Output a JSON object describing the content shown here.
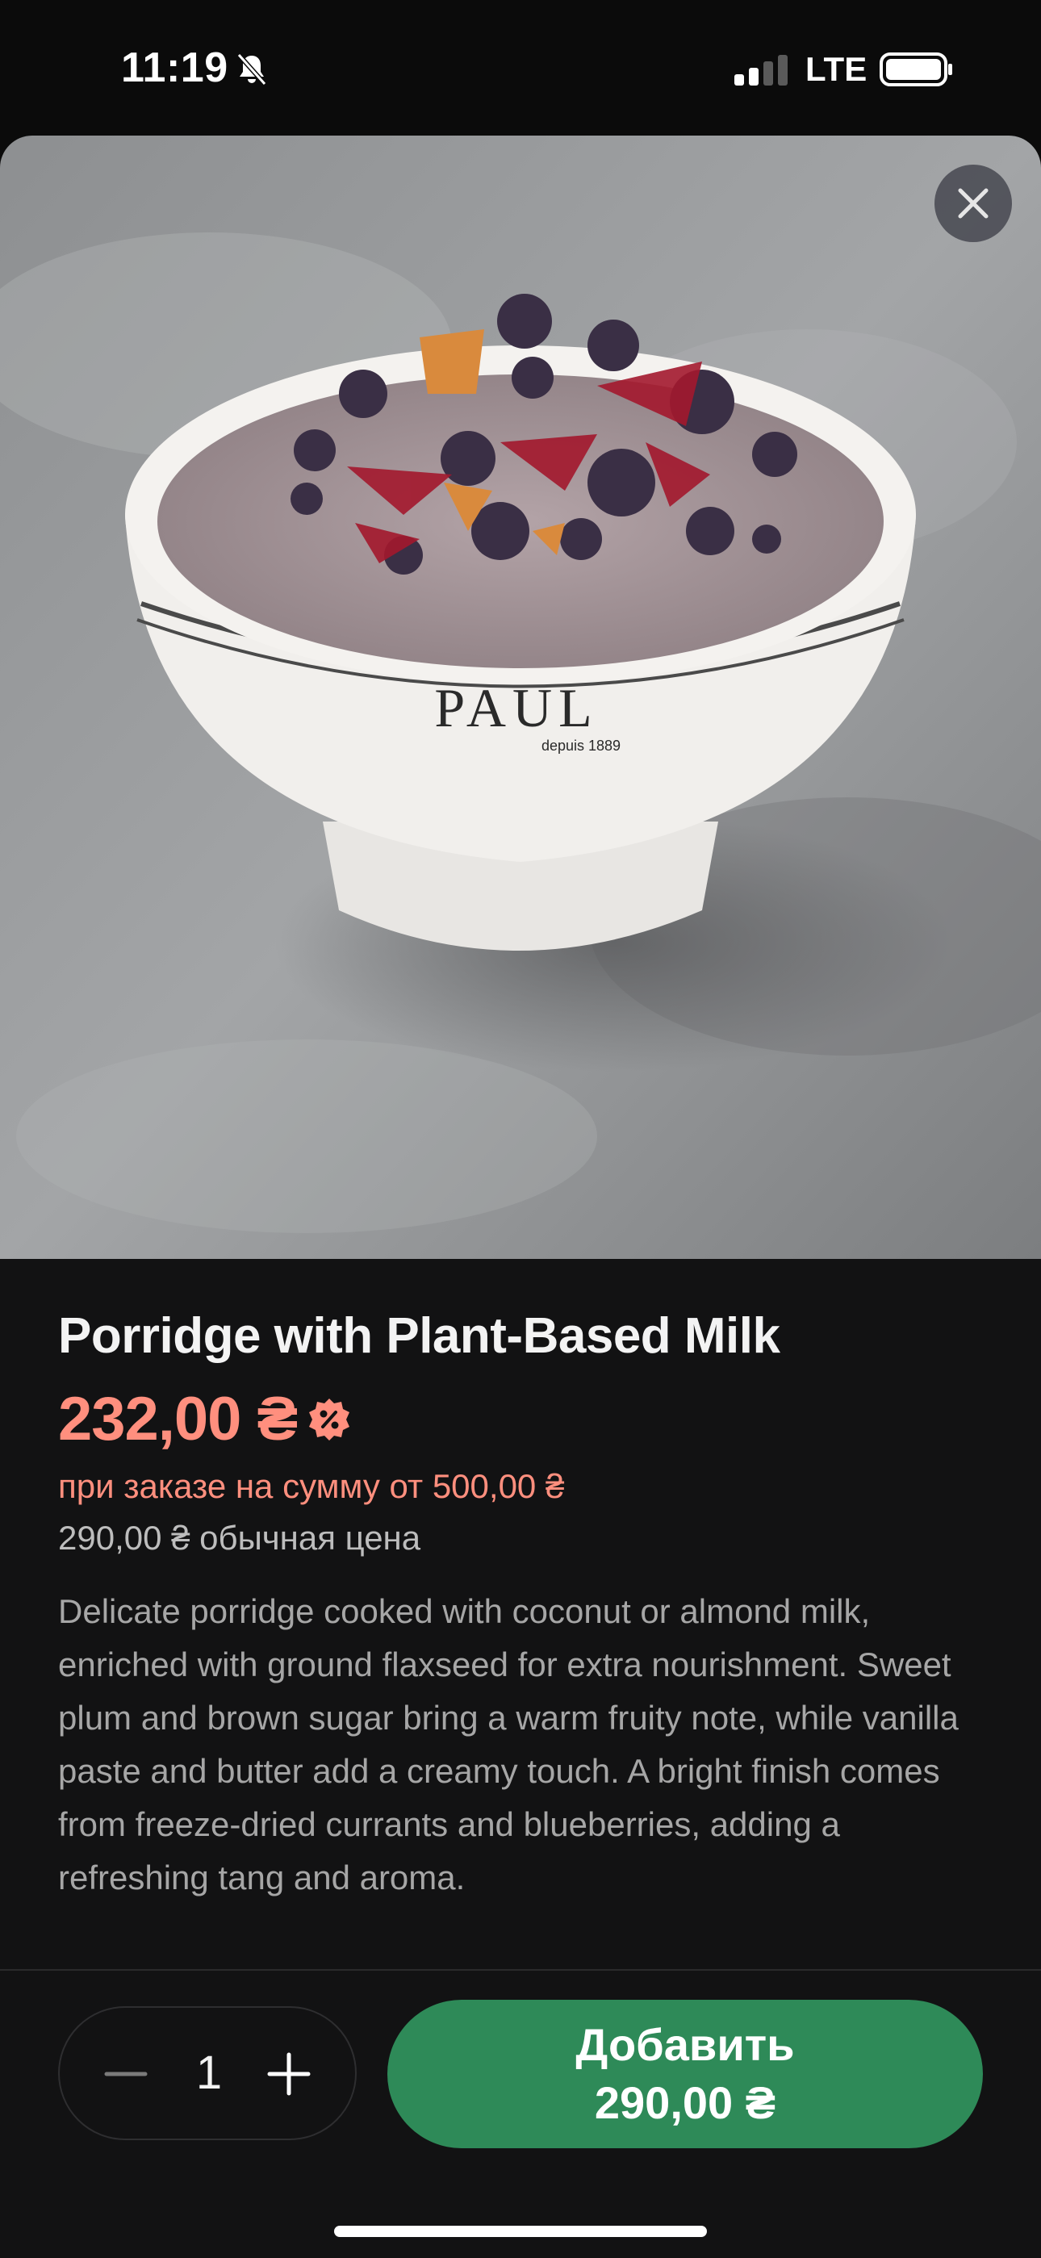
{
  "status_bar": {
    "time": "11:19",
    "network": "LTE"
  },
  "product": {
    "title": "Porridge with Plant-Based Milk",
    "promo_price": "232,00 ₴",
    "promo_condition": "при заказе на сумму от 500,00 ₴",
    "regular_price": "290,00 ₴ обычная цена",
    "description": "Delicate porridge cooked with coconut or almond milk, enriched with ground flaxseed for extra nourishment. Sweet plum and brown sugar bring a warm fruity note, while vanilla paste and butter add a creamy touch. A bright finish comes from freeze-dried currants and blueberries, adding a refreshing tang and aroma.",
    "image_logo": "PAUL",
    "image_logo_sub": "depuis 1889"
  },
  "cart": {
    "quantity": "1",
    "add_label": "Добавить",
    "add_price": "290,00 ₴"
  },
  "colors": {
    "accent_green": "#2e8a58",
    "promo_salmon": "#ff8f7e",
    "background": "#121213"
  },
  "icons": [
    "bell-slash-icon",
    "signal-icon",
    "battery-icon",
    "close-icon",
    "discount-icon",
    "minus-icon",
    "plus-icon"
  ]
}
